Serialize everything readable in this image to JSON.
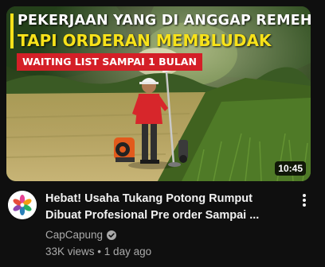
{
  "video": {
    "thumbnail": {
      "headline_line1": "PEKERJAAN YANG DI ANGGAP REMEH",
      "headline_line2": "TAPI ORDERAN MEMBLUDAK",
      "banner": "WAITING LIST SAMPAI 1 BULAN",
      "duration": "10:45",
      "colors": {
        "headline_line1": "#ffffff",
        "headline_line2": "#f7e21a",
        "banner_bg": "#d41f27",
        "accent_bar": "#f7e21a"
      }
    },
    "title_line1": "Hebat! Usaha Tukang Potong Rumput",
    "title_line2": "Dibuat Profesional Pre order Sampai ...",
    "channel": "CapCapung",
    "views": "33K views",
    "separator": "•",
    "age": "1 day ago"
  },
  "icons": {
    "avatar": "flower-logo-icon",
    "verified": "verified-check-icon",
    "menu": "more-vert-icon"
  },
  "theme": {
    "background": "#0f0f0f",
    "title_color": "#f1f1f1",
    "secondary_text": "#aaaaaa"
  }
}
